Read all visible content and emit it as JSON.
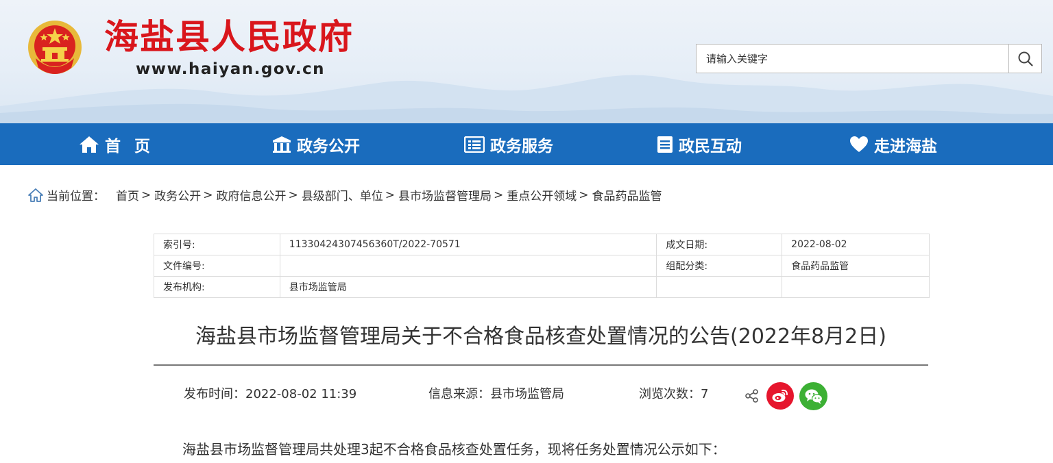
{
  "header": {
    "site_title": "海盐县人民政府",
    "site_url": "www.haiyan.gov.cn",
    "search_placeholder": "请输入关键字",
    "title_color": "#d9161c"
  },
  "nav": {
    "background": "#1a6cbd",
    "items": [
      {
        "label": "首页",
        "icon": "home-icon"
      },
      {
        "label": "政务公开",
        "icon": "building-icon"
      },
      {
        "label": "政务服务",
        "icon": "list-icon"
      },
      {
        "label": "政民互动",
        "icon": "document-icon"
      },
      {
        "label": "走进海盐",
        "icon": "heart-icon"
      }
    ]
  },
  "breadcrumb": {
    "label": "当前位置：",
    "items": [
      "首页",
      "政务公开",
      "政府信息公开",
      "县级部门、单位",
      "县市场监督管理局",
      "重点公开领域",
      "食品药品监管"
    ],
    "separator": ">"
  },
  "info": {
    "rows": [
      [
        "索引号:",
        "11330424307456360T/2022-70571",
        "成文日期:",
        "2022-08-02"
      ],
      [
        "文件编号:",
        "",
        "组配分类:",
        "食品药品监管"
      ],
      [
        "发布机构:",
        "县市场监管局",
        "",
        ""
      ]
    ]
  },
  "article": {
    "title": "海盐县市场监督管理局关于不合格食品核查处置情况的公告(2022年8月2日)",
    "publish_time": "发布时间：2022-08-02 11:39",
    "source": "信息来源：县市场监管局",
    "views": "浏览次数：7",
    "body": "海盐县市场监督管理局共处理3起不合格食品核查处置任务，现将任务处置情况公示如下："
  }
}
